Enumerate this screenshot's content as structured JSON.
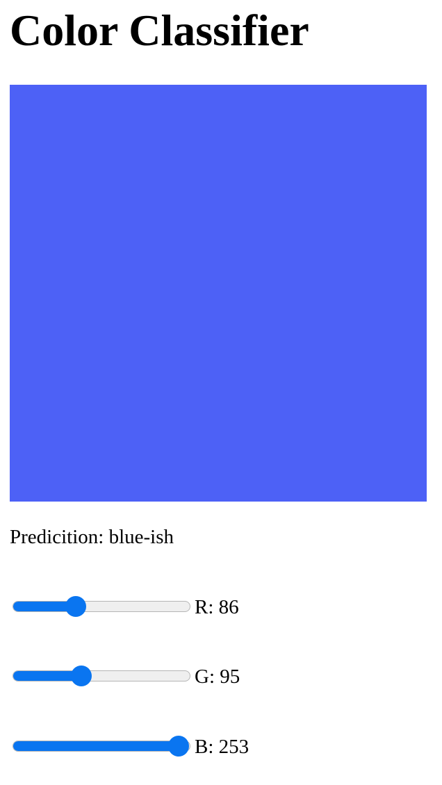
{
  "title": "Color Classifier",
  "swatch": {
    "color": "#4d61f6"
  },
  "prediction": {
    "label": "Predicition:",
    "value": "blue-ish"
  },
  "sliders": [
    {
      "label": "R:",
      "value": 86,
      "min": 0,
      "max": 255
    },
    {
      "label": "G:",
      "value": 95,
      "min": 0,
      "max": 255
    },
    {
      "label": "B:",
      "value": 253,
      "min": 0,
      "max": 255
    }
  ],
  "colors": {
    "slider_accent": "#0a75f0",
    "track": "#efefef"
  }
}
